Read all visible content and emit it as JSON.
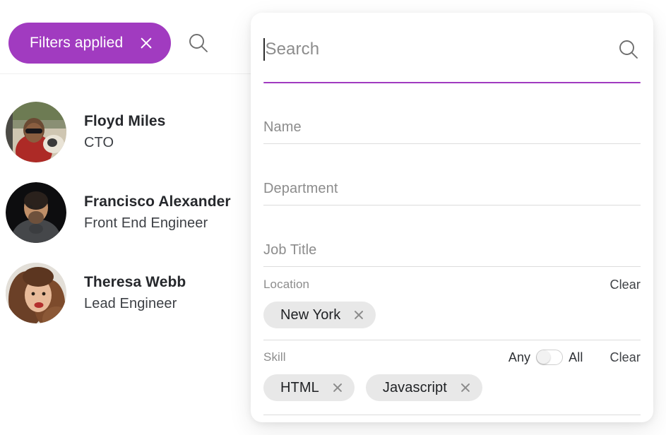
{
  "left_panel": {
    "filters_pill": {
      "label": "Filters applied",
      "close_icon": "close-icon",
      "color": "#A13BC0"
    },
    "search_icon": "search-icon",
    "people": [
      {
        "name": "Floyd Miles",
        "role": "CTO",
        "avatar": "photo-man-sunglasses-red-shirt"
      },
      {
        "name": "Francisco Alexander",
        "role": "Front End Engineer",
        "avatar": "photo-man-dark-background"
      },
      {
        "name": "Theresa Webb",
        "role": "Lead Engineer",
        "avatar": "photo-woman-long-hair"
      }
    ]
  },
  "filter_panel": {
    "search": {
      "placeholder": "Search",
      "value": "",
      "icon": "search-icon",
      "underline_color": "#A13BC0"
    },
    "fields": [
      {
        "label": "Name",
        "value": ""
      },
      {
        "label": "Department",
        "value": ""
      },
      {
        "label": "Job Title",
        "value": ""
      }
    ],
    "location": {
      "label": "Location",
      "clear_label": "Clear",
      "chips": [
        {
          "label": "New York",
          "remove_icon": "close-icon"
        }
      ]
    },
    "skill": {
      "label": "Skill",
      "clear_label": "Clear",
      "match_any_label": "Any",
      "match_all_label": "All",
      "match_selected": "Any",
      "chips": [
        {
          "label": "HTML",
          "remove_icon": "close-icon"
        },
        {
          "label": "Javascript",
          "remove_icon": "close-icon"
        }
      ]
    }
  }
}
